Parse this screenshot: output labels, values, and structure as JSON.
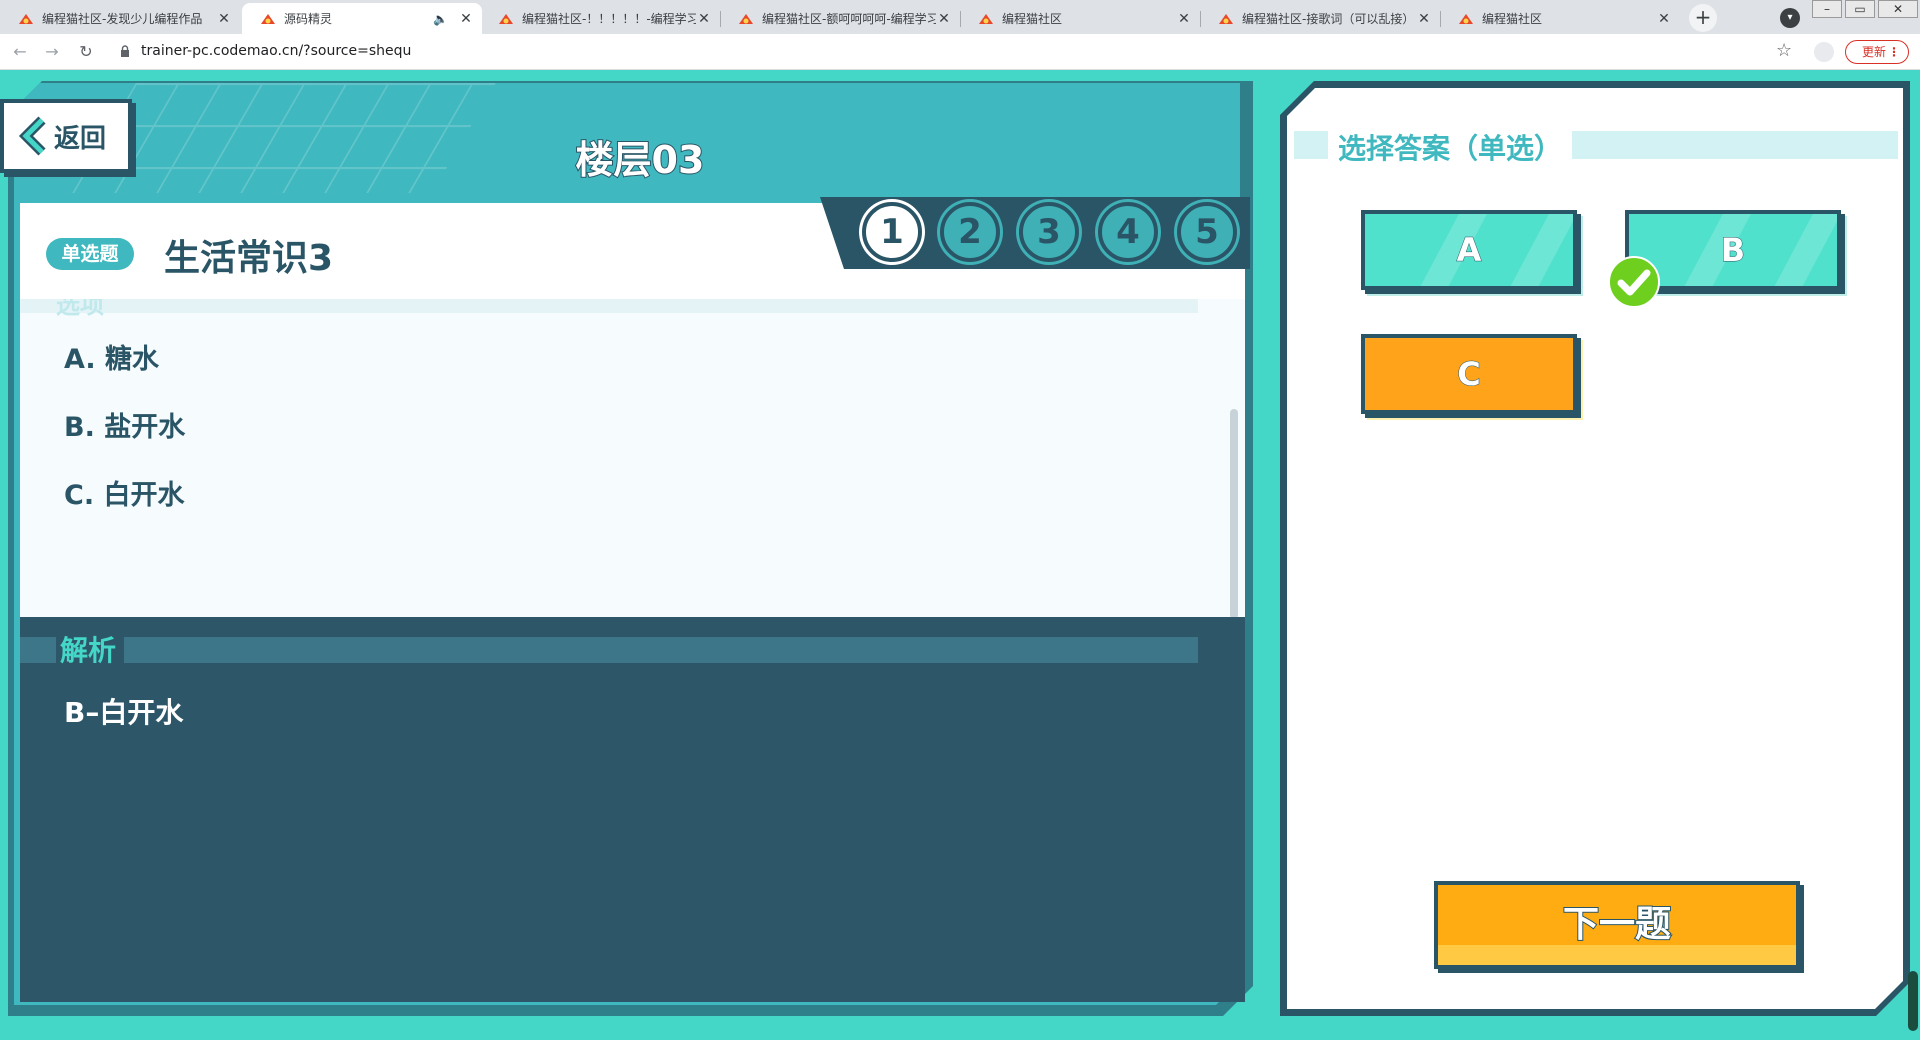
{
  "browser": {
    "tabs": [
      {
        "title": "编程猫社区-发现少儿编程作品",
        "active": false
      },
      {
        "title": "源码精灵",
        "active": true,
        "audio": true
      },
      {
        "title": "编程猫社区-！！！！！-编程学习",
        "active": false
      },
      {
        "title": "编程猫社区-额呵呵呵呵-编程学习",
        "active": false
      },
      {
        "title": "编程猫社区",
        "active": false
      },
      {
        "title": "编程猫社区-接歌词（可以乱接）",
        "active": false
      },
      {
        "title": "编程猫社区",
        "active": false
      }
    ],
    "url": "trainer-pc.codemao.cn/?source=shequ",
    "update_label": "更新"
  },
  "quiz": {
    "back_label": "返回",
    "floor_title": "楼层03",
    "steps": [
      "1",
      "2",
      "3",
      "4",
      "5"
    ],
    "active_step": 1,
    "question_type": "单选题",
    "question_title": "生活常识3",
    "options_heading": "选项",
    "options": [
      "A. 糖水",
      "B. 盐开水",
      "C. 白开水"
    ],
    "analysis_heading": "解析",
    "analysis_text": "B–白开水"
  },
  "answer_panel": {
    "title": "选择答案（单选）",
    "choices": [
      {
        "label": "A",
        "state": "normal"
      },
      {
        "label": "B",
        "state": "correct"
      },
      {
        "label": "C",
        "state": "selected"
      }
    ],
    "next_label": "下一题"
  },
  "colors": {
    "teal_bg": "#44d6c6",
    "navy": "#2a5566",
    "orange": "#ffa31a",
    "check_green": "#6ecf1f"
  }
}
